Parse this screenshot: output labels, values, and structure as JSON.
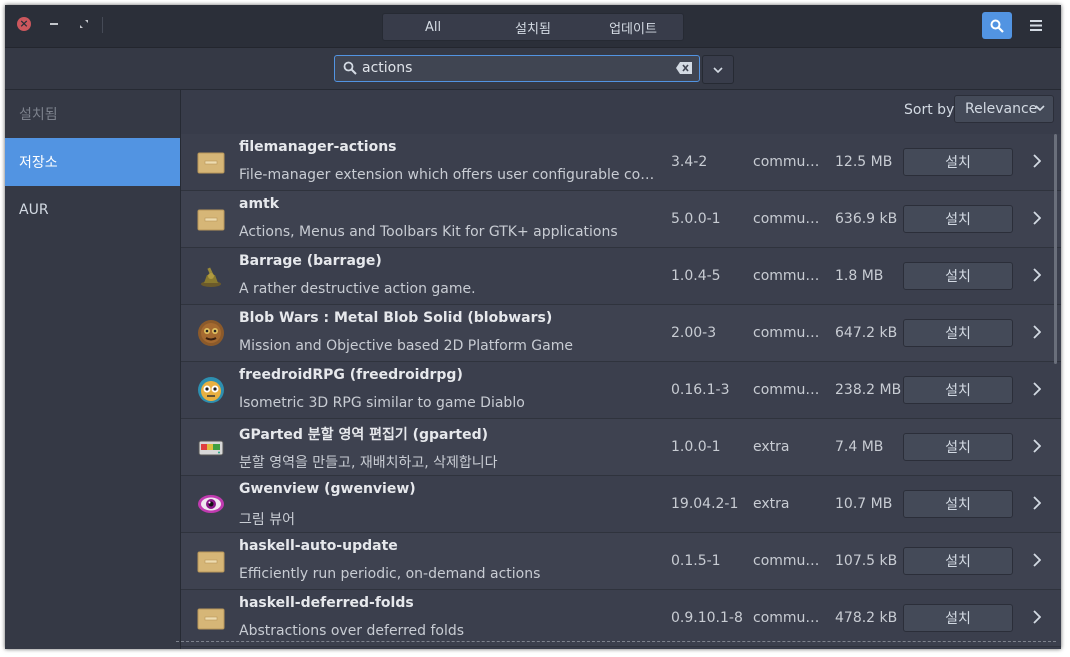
{
  "header": {
    "window_controls": {
      "close": "close-icon",
      "minimize": "minimize-icon",
      "maximize": "maximize-icon"
    },
    "modes": [
      {
        "label": "All"
      },
      {
        "label": "설치됨"
      },
      {
        "label": "업데이트"
      }
    ]
  },
  "search": {
    "value": "actions",
    "placeholder": ""
  },
  "sidebar": {
    "items": [
      {
        "label": "설치됨"
      },
      {
        "label": "저장소"
      },
      {
        "label": "AUR"
      }
    ]
  },
  "sort": {
    "label": "Sort by",
    "selected": "Relevance"
  },
  "packages": [
    {
      "name": "filemanager-actions",
      "desc": "File-manager extension which offers user configurable context m…",
      "version": "3.4-2",
      "repo": "commun…",
      "size": "12.5 MB",
      "button": "설치",
      "icon": "package-box"
    },
    {
      "name": "amtk",
      "desc": "Actions, Menus and Toolbars Kit for GTK+ applications",
      "version": "5.0.0-1",
      "repo": "commun…",
      "size": "636.9 kB",
      "button": "설치",
      "icon": "package-box"
    },
    {
      "name": "Barrage  (barrage)",
      "desc": "A rather destructive action game.",
      "version": "1.0.4-5",
      "repo": "commun…",
      "size": "1.8 MB",
      "button": "설치",
      "icon": "barrage-tank"
    },
    {
      "name": "Blob Wars : Metal Blob Solid  (blobwars)",
      "desc": "Mission and Objective based 2D Platform Game",
      "version": "2.00-3",
      "repo": "commun…",
      "size": "647.2 kB",
      "button": "설치",
      "icon": "blobwars"
    },
    {
      "name": "freedroidRPG  (freedroidrpg)",
      "desc": "Isometric 3D RPG similar to game Diablo",
      "version": "0.16.1-3",
      "repo": "commun…",
      "size": "238.2 MB",
      "button": "설치",
      "icon": "freedroid"
    },
    {
      "name": "GParted 분할 영역 편집기  (gparted)",
      "desc": "분할 영역을 만들고, 재배치하고, 삭제합니다",
      "version": "1.0.0-1",
      "repo": "extra",
      "size": "7.4 MB",
      "button": "설치",
      "icon": "gparted-disk"
    },
    {
      "name": "Gwenview  (gwenview)",
      "desc": "그림 뷰어",
      "version": "19.04.2-1",
      "repo": "extra",
      "size": "10.7 MB",
      "button": "설치",
      "icon": "gwenview-eye"
    },
    {
      "name": "haskell-auto-update",
      "desc": "Efficiently run periodic, on-demand actions",
      "version": "0.1.5-1",
      "repo": "commun…",
      "size": "107.5 kB",
      "button": "설치",
      "icon": "package-box"
    },
    {
      "name": "haskell-deferred-folds",
      "desc": "Abstractions over deferred folds",
      "version": "0.9.10.1-8",
      "repo": "commun…",
      "size": "478.2 kB",
      "button": "설치",
      "icon": "package-box"
    }
  ]
}
